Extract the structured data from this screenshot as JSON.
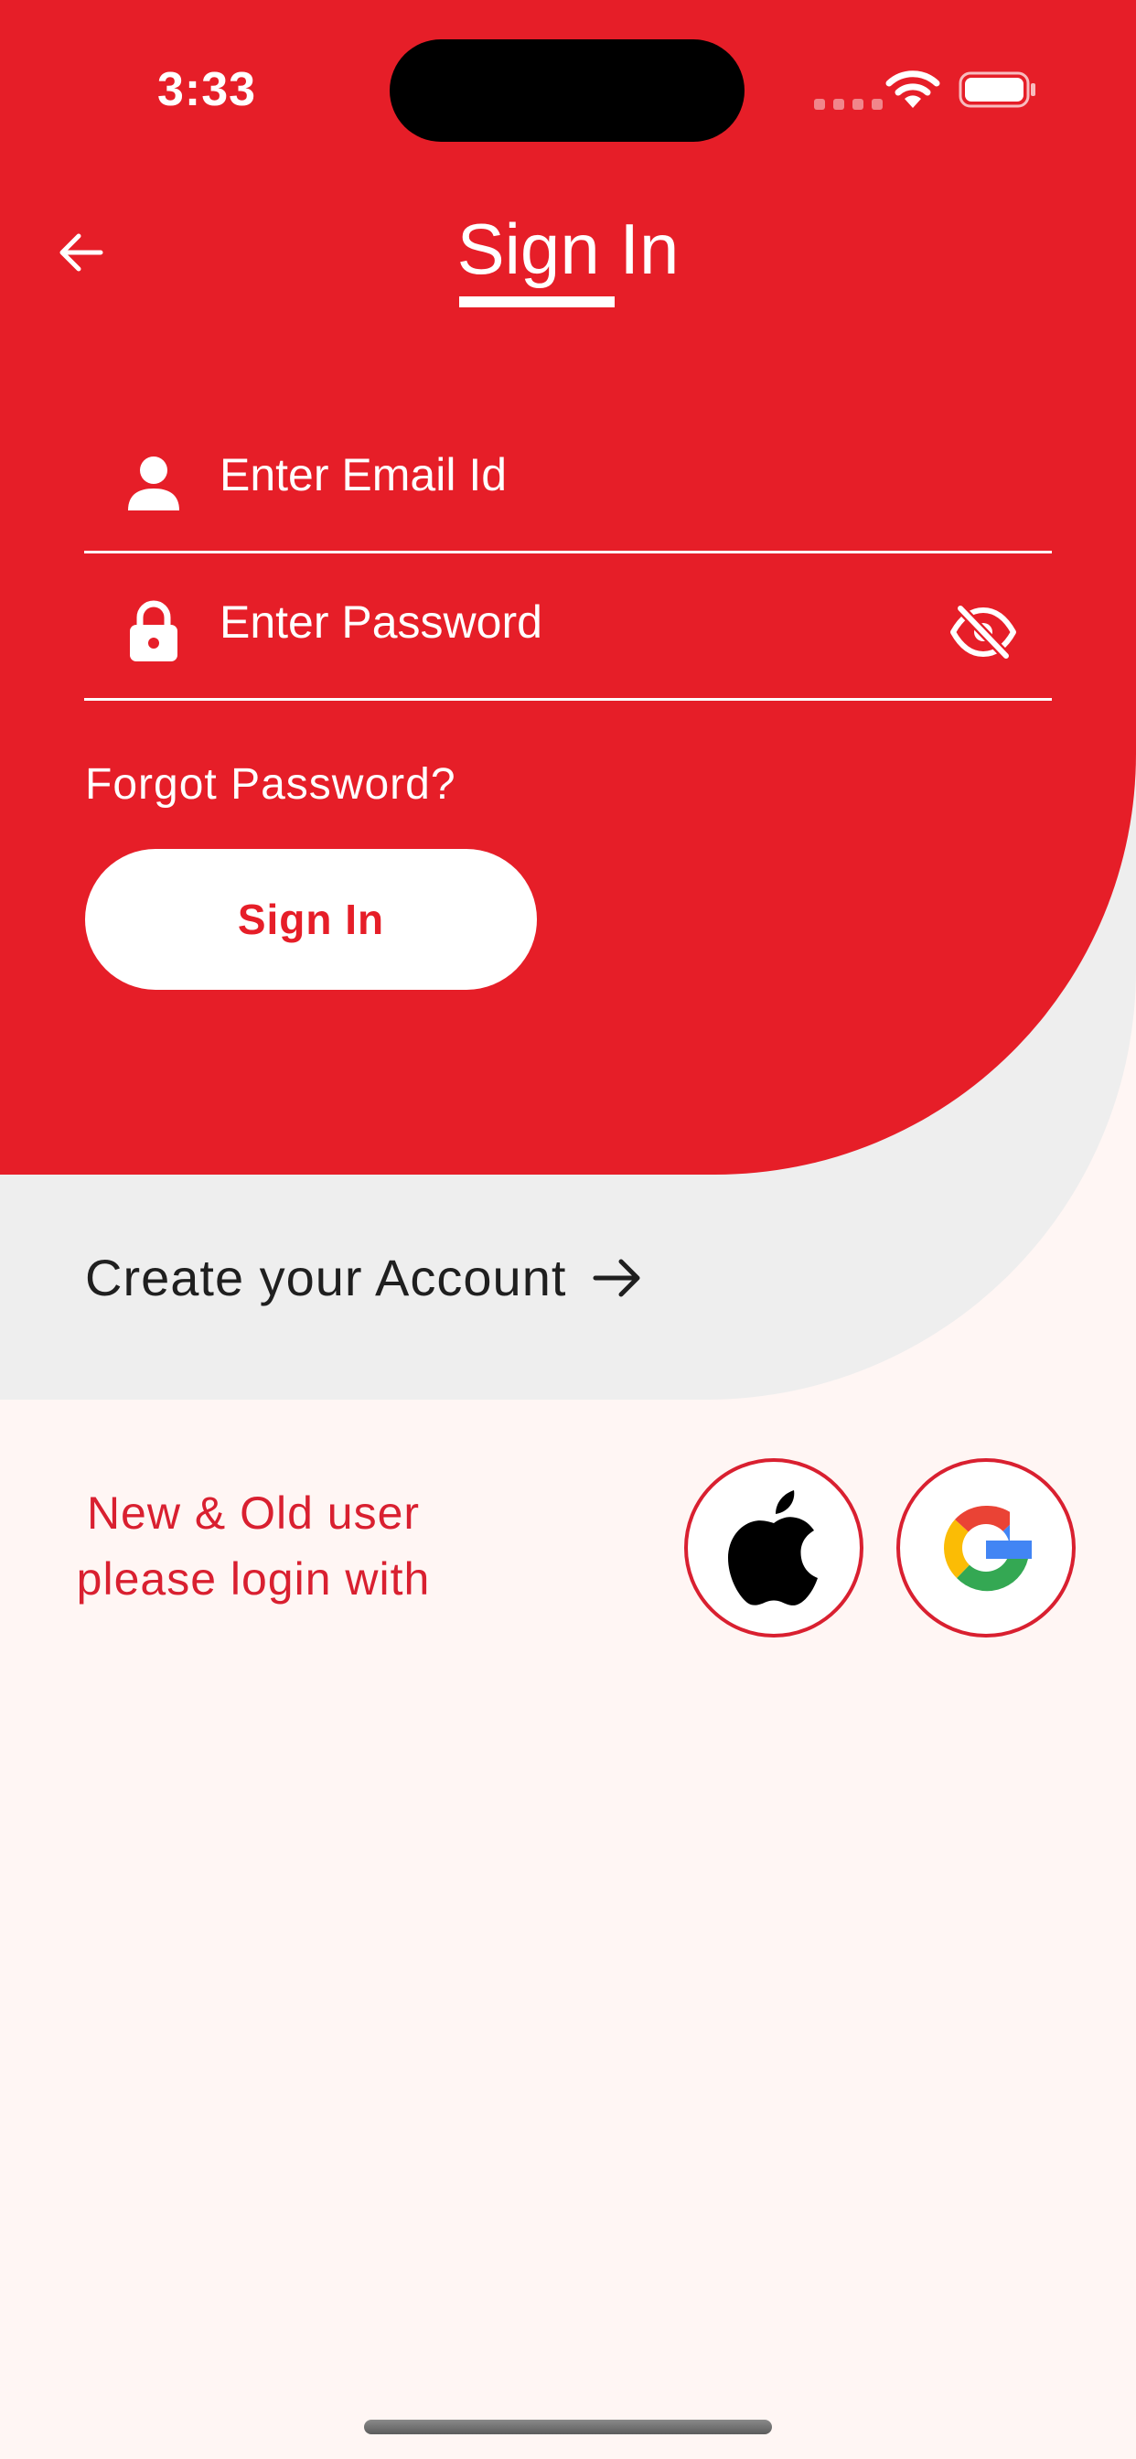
{
  "status_bar": {
    "time": "3:33"
  },
  "header": {
    "title": "Sign In",
    "back_icon": "arrow-left-icon"
  },
  "form": {
    "email": {
      "placeholder": "Enter Email Id",
      "value": "",
      "icon": "person-icon"
    },
    "password": {
      "placeholder": "Enter Password",
      "value": "",
      "icon": "lock-icon",
      "toggle_icon": "eye-off-icon"
    },
    "forgot_label": "Forgot Password?",
    "submit_label": "Sign In"
  },
  "create_account": {
    "label": "Create your Account",
    "icon": "arrow-right-icon"
  },
  "social_login": {
    "text_line1": "New & Old user",
    "text_line2": "please login with",
    "providers": [
      {
        "name": "Apple",
        "icon": "apple-icon"
      },
      {
        "name": "Google",
        "icon": "google-icon"
      }
    ]
  },
  "colors": {
    "primary": "#e61e28",
    "accent_text": "#d92030",
    "background": "#fff6f4",
    "secondary_panel": "#eeeeee"
  }
}
